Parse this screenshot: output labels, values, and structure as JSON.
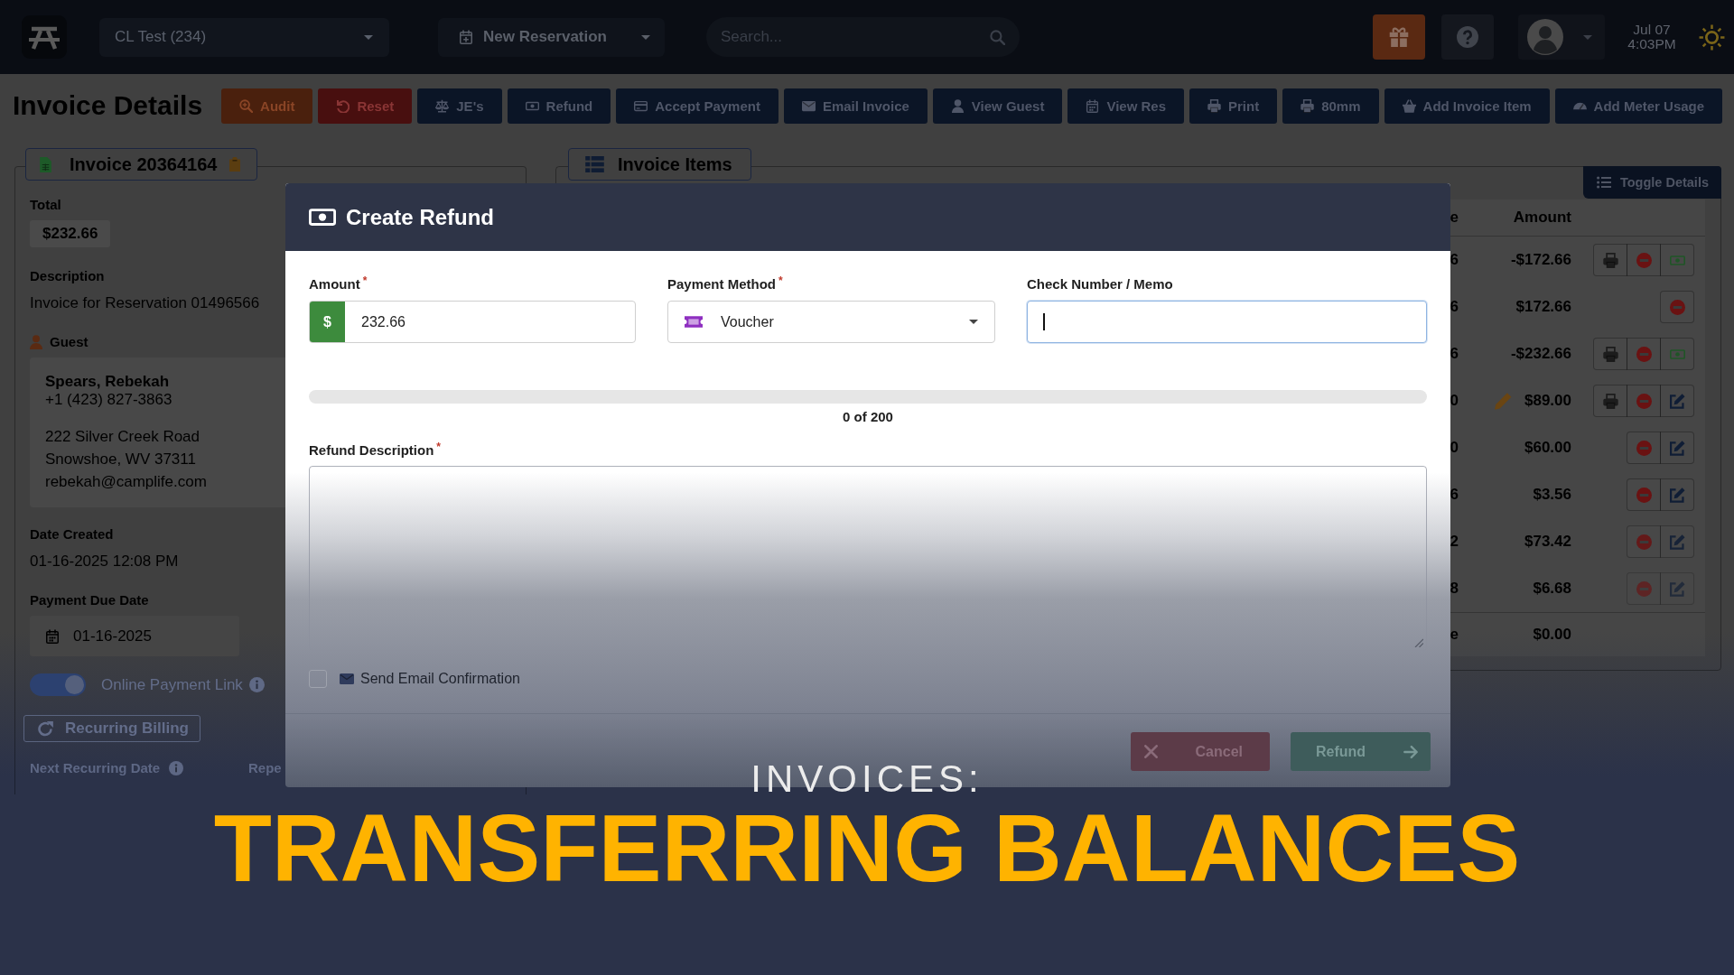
{
  "top_bar": {
    "location_select": {
      "value": "CL Test (234)"
    },
    "new_reservation_button": {
      "label": "New Reservation"
    },
    "search": {
      "placeholder": "Search..."
    },
    "clock": {
      "date": "Jul 07",
      "time": "4:03PM"
    }
  },
  "header": {
    "title": "Invoice Details",
    "actions": [
      {
        "label": "Audit",
        "kind": "warning"
      },
      {
        "label": "Reset",
        "kind": "danger"
      },
      {
        "label": "JE's",
        "kind": "primary"
      },
      {
        "label": "Refund",
        "kind": "primary"
      },
      {
        "label": "Accept Payment",
        "kind": "primary"
      },
      {
        "label": "Email Invoice",
        "kind": "primary"
      },
      {
        "label": "View Guest",
        "kind": "primary"
      },
      {
        "label": "View Res",
        "kind": "primary"
      },
      {
        "label": "Print",
        "kind": "primary"
      },
      {
        "label": "80mm",
        "kind": "primary"
      },
      {
        "label": "Add Invoice Item",
        "kind": "primary"
      },
      {
        "label": "Add Meter Usage",
        "kind": "primary"
      }
    ]
  },
  "invoice_panel": {
    "title": "Invoice 20364164",
    "total": {
      "label": "Total",
      "value": "$232.66"
    },
    "description": {
      "label": "Description",
      "value": "Invoice for Reservation 01496566"
    },
    "guest": {
      "label": "Guest",
      "name": "Spears, Rebekah",
      "phone": "+1 (423) 827-3863",
      "address_lines": [
        "222 Silver Creek Road",
        "Snowshoe, WV 37311"
      ],
      "email": "rebekah@camplife.com"
    },
    "date_created": {
      "label": "Date Created",
      "value": "01-16-2025 12:08 PM"
    },
    "payment_due_date": {
      "label": "Payment Due Date",
      "value": "01-16-2025"
    },
    "online_payment_link": {
      "label": "Online Payment Link",
      "on": true
    },
    "recurring_billing_button": {
      "label": "Recurring Billing"
    },
    "next_recurring_date": {
      "label": "Next Recurring Date"
    },
    "column_2_label": "Repe"
  },
  "items_panel": {
    "title": "Invoice Items",
    "toggle_details_button": {
      "label": "Toggle Details"
    },
    "columns": [
      "e",
      "Amount"
    ],
    "rows": [
      {
        "column_1": "6",
        "amount": "-$172.66",
        "edited": false,
        "actions": [
          {
            "kind": "print"
          },
          {
            "kind": "remove"
          },
          {
            "kind": "payment"
          }
        ]
      },
      {
        "column_1": "6",
        "amount": "$172.66",
        "edited": false,
        "actions": [
          {
            "kind": "remove"
          }
        ]
      },
      {
        "column_1": "6",
        "amount": "-$232.66",
        "edited": false,
        "actions": [
          {
            "kind": "print"
          },
          {
            "kind": "remove"
          },
          {
            "kind": "payment"
          }
        ]
      },
      {
        "column_1": "0",
        "amount": "$89.00",
        "edited": true,
        "actions": [
          {
            "kind": "print"
          },
          {
            "kind": "remove"
          },
          {
            "kind": "edit"
          }
        ]
      },
      {
        "column_1": "0",
        "amount": "$60.00",
        "edited": false,
        "actions": [
          {
            "kind": "remove"
          },
          {
            "kind": "edit"
          }
        ]
      },
      {
        "column_1": "6",
        "amount": "$3.56",
        "edited": false,
        "actions": [
          {
            "kind": "remove"
          },
          {
            "kind": "edit"
          }
        ]
      },
      {
        "column_1": "2",
        "amount": "$73.42",
        "edited": false,
        "actions": [
          {
            "kind": "remove"
          },
          {
            "kind": "edit"
          }
        ]
      },
      {
        "column_1": "8",
        "amount": "$6.68",
        "edited": false,
        "actions": [
          {
            "kind": "remove"
          },
          {
            "kind": "edit"
          }
        ]
      },
      {
        "column_1": "e",
        "amount": "$0.00",
        "edited": false
      }
    ]
  },
  "refund_dialog": {
    "title": "Create Refund",
    "amount": {
      "label": "Amount$^{*}$",
      "prefix": "$",
      "value": "232.66"
    },
    "payment_method": {
      "label": "Payment Method$^{*}$",
      "value": "Voucher"
    },
    "check_number_memo": {
      "label": "Check Number / Memo",
      "focused": true
    },
    "character_count": {
      "level": 0,
      "text": "0 of 200"
    },
    "refund_description": {
      "label": "Refund Description$^{*}$"
    },
    "send_email_confirmation": {
      "label": "Send Email Confirmation",
      "checked": false
    },
    "buttons": [
      {
        "label": "Cancel",
        "kind": "cancel"
      },
      {
        "label": "Refund",
        "kind": "submit"
      }
    ]
  },
  "title_card": {
    "kicker": "INVOICES:",
    "headline": "TRANSFERRING BALANCES"
  }
}
